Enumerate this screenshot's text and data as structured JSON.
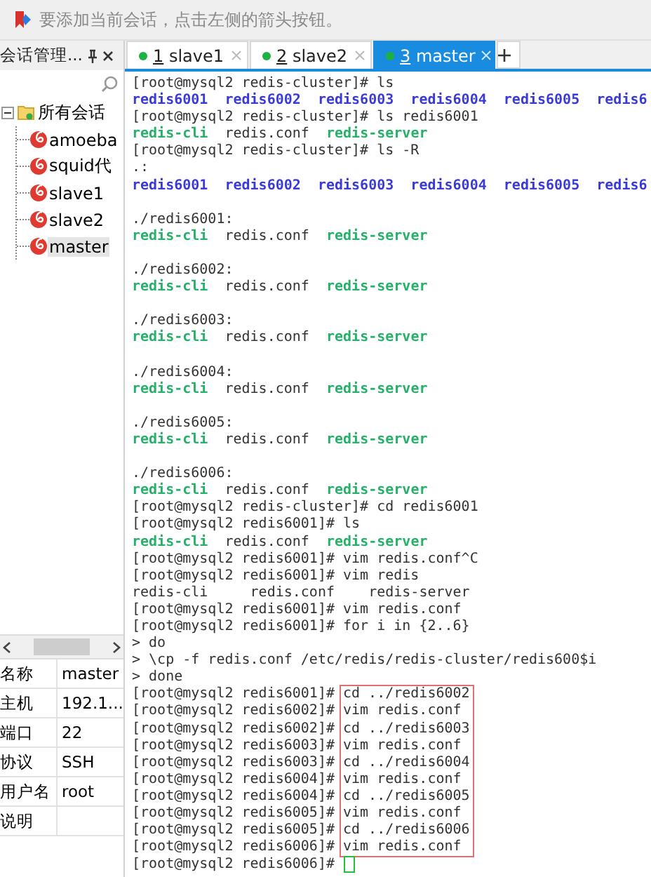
{
  "toolbar": {
    "hint": "要添加当前会话，点击左侧的箭头按钮。"
  },
  "session_panel": {
    "title": "会话管理...",
    "tree": {
      "label": "所有会话",
      "expanded": true,
      "children": [
        {
          "label": "amoeba",
          "selected": false
        },
        {
          "label": "squid代",
          "selected": false
        },
        {
          "label": "slave1",
          "selected": false
        },
        {
          "label": "slave2",
          "selected": false
        },
        {
          "label": "master",
          "selected": true
        }
      ]
    },
    "properties": [
      {
        "name": "名称",
        "value": "master"
      },
      {
        "name": "主机",
        "value": "192.1..."
      },
      {
        "name": "端口",
        "value": "22"
      },
      {
        "name": "协议",
        "value": "SSH"
      },
      {
        "name": "用户名",
        "value": "root"
      },
      {
        "name": "说明"
      }
    ]
  },
  "tabs": [
    {
      "number": "1",
      "label": "slave1",
      "selected": false
    },
    {
      "number": "2",
      "label": "slave2",
      "selected": false
    },
    {
      "number": "3",
      "label": "master",
      "selected": true
    }
  ],
  "terminal": {
    "lines": [
      {
        "kind": "text",
        "segments": [
          {
            "kind": "plain",
            "text": "[root@mysql2 redis-cluster]# ls"
          }
        ]
      },
      {
        "kind": "text",
        "segments": [
          {
            "kind": "dir",
            "text": "redis6001  redis6002  redis6003  redis6004  redis6005  redis6"
          }
        ]
      },
      {
        "kind": "text",
        "segments": [
          {
            "kind": "plain",
            "text": "[root@mysql2 redis-cluster]# ls redis6001"
          }
        ]
      },
      {
        "kind": "text",
        "segments": [
          {
            "kind": "exec",
            "text": "redis-cli"
          },
          {
            "kind": "plain",
            "text": "  redis.conf  "
          },
          {
            "kind": "exec",
            "text": "redis-server"
          }
        ]
      },
      {
        "kind": "text",
        "segments": [
          {
            "kind": "plain",
            "text": "[root@mysql2 redis-cluster]# ls -R"
          }
        ]
      },
      {
        "kind": "text",
        "segments": [
          {
            "kind": "plain",
            "text": ".:"
          }
        ]
      },
      {
        "kind": "text",
        "segments": [
          {
            "kind": "dir",
            "text": "redis6001  redis6002  redis6003  redis6004  redis6005  redis6"
          }
        ]
      },
      {
        "kind": "blank"
      },
      {
        "kind": "text",
        "segments": [
          {
            "kind": "plain",
            "text": "./redis6001:"
          }
        ]
      },
      {
        "kind": "text",
        "segments": [
          {
            "kind": "exec",
            "text": "redis-cli"
          },
          {
            "kind": "plain",
            "text": "  redis.conf  "
          },
          {
            "kind": "exec",
            "text": "redis-server"
          }
        ]
      },
      {
        "kind": "blank"
      },
      {
        "kind": "text",
        "segments": [
          {
            "kind": "plain",
            "text": "./redis6002:"
          }
        ]
      },
      {
        "kind": "text",
        "segments": [
          {
            "kind": "exec",
            "text": "redis-cli"
          },
          {
            "kind": "plain",
            "text": "  redis.conf  "
          },
          {
            "kind": "exec",
            "text": "redis-server"
          }
        ]
      },
      {
        "kind": "blank"
      },
      {
        "kind": "text",
        "segments": [
          {
            "kind": "plain",
            "text": "./redis6003:"
          }
        ]
      },
      {
        "kind": "text",
        "segments": [
          {
            "kind": "exec",
            "text": "redis-cli"
          },
          {
            "kind": "plain",
            "text": "  redis.conf  "
          },
          {
            "kind": "exec",
            "text": "redis-server"
          }
        ]
      },
      {
        "kind": "blank"
      },
      {
        "kind": "text",
        "segments": [
          {
            "kind": "plain",
            "text": "./redis6004:"
          }
        ]
      },
      {
        "kind": "text",
        "segments": [
          {
            "kind": "exec",
            "text": "redis-cli"
          },
          {
            "kind": "plain",
            "text": "  redis.conf  "
          },
          {
            "kind": "exec",
            "text": "redis-server"
          }
        ]
      },
      {
        "kind": "blank"
      },
      {
        "kind": "text",
        "segments": [
          {
            "kind": "plain",
            "text": "./redis6005:"
          }
        ]
      },
      {
        "kind": "text",
        "segments": [
          {
            "kind": "exec",
            "text": "redis-cli"
          },
          {
            "kind": "plain",
            "text": "  redis.conf  "
          },
          {
            "kind": "exec",
            "text": "redis-server"
          }
        ]
      },
      {
        "kind": "blank"
      },
      {
        "kind": "text",
        "segments": [
          {
            "kind": "plain",
            "text": "./redis6006:"
          }
        ]
      },
      {
        "kind": "text",
        "segments": [
          {
            "kind": "exec",
            "text": "redis-cli"
          },
          {
            "kind": "plain",
            "text": "  redis.conf  "
          },
          {
            "kind": "exec",
            "text": "redis-server"
          }
        ]
      },
      {
        "kind": "text",
        "segments": [
          {
            "kind": "plain",
            "text": "[root@mysql2 redis-cluster]# cd redis6001"
          }
        ]
      },
      {
        "kind": "text",
        "segments": [
          {
            "kind": "plain",
            "text": "[root@mysql2 redis6001]# ls"
          }
        ]
      },
      {
        "kind": "text",
        "segments": [
          {
            "kind": "exec",
            "text": "redis-cli"
          },
          {
            "kind": "plain",
            "text": "  redis.conf  "
          },
          {
            "kind": "exec",
            "text": "redis-server"
          }
        ]
      },
      {
        "kind": "text",
        "segments": [
          {
            "kind": "plain",
            "text": "[root@mysql2 redis6001]# vim redis.conf^C"
          }
        ]
      },
      {
        "kind": "text",
        "segments": [
          {
            "kind": "plain",
            "text": "[root@mysql2 redis6001]# vim redis"
          }
        ]
      },
      {
        "kind": "text",
        "segments": [
          {
            "kind": "plain",
            "text": "redis-cli     redis.conf    redis-server"
          }
        ]
      },
      {
        "kind": "text",
        "segments": [
          {
            "kind": "plain",
            "text": "[root@mysql2 redis6001]# vim redis.conf"
          }
        ]
      },
      {
        "kind": "text",
        "segments": [
          {
            "kind": "plain",
            "text": "[root@mysql2 redis6001]# for i in {2..6}"
          }
        ]
      },
      {
        "kind": "text",
        "segments": [
          {
            "kind": "plain",
            "text": "> do"
          }
        ]
      },
      {
        "kind": "text",
        "segments": [
          {
            "kind": "plain",
            "text": "> \\cp -f redis.conf /etc/redis/redis-cluster/redis600$i"
          }
        ]
      },
      {
        "kind": "text",
        "segments": [
          {
            "kind": "plain",
            "text": "> done"
          }
        ]
      },
      {
        "kind": "highlight",
        "rows": [
          {
            "prompt": "[root@mysql2 redis6001]#",
            "command": "cd ../redis6002"
          },
          {
            "prompt": "[root@mysql2 redis6002]#",
            "command": "vim redis.conf"
          },
          {
            "prompt": "[root@mysql2 redis6002]#",
            "command": "cd ../redis6003"
          },
          {
            "prompt": "[root@mysql2 redis6003]#",
            "command": "vim redis.conf"
          },
          {
            "prompt": "[root@mysql2 redis6003]#",
            "command": "cd ../redis6004"
          },
          {
            "prompt": "[root@mysql2 redis6004]#",
            "command": "vim redis.conf"
          },
          {
            "prompt": "[root@mysql2 redis6004]#",
            "command": "cd ../redis6005"
          },
          {
            "prompt": "[root@mysql2 redis6005]#",
            "command": "vim redis.conf"
          },
          {
            "prompt": "[root@mysql2 redis6005]#",
            "command": "cd ../redis6006"
          },
          {
            "prompt": "[root@mysql2 redis6006]#",
            "command": "vim redis.conf"
          }
        ]
      },
      {
        "kind": "text",
        "segments": [
          {
            "kind": "plain",
            "text": "[root@mysql2 redis6006]#"
          }
        ],
        "cursor": true
      }
    ]
  }
}
